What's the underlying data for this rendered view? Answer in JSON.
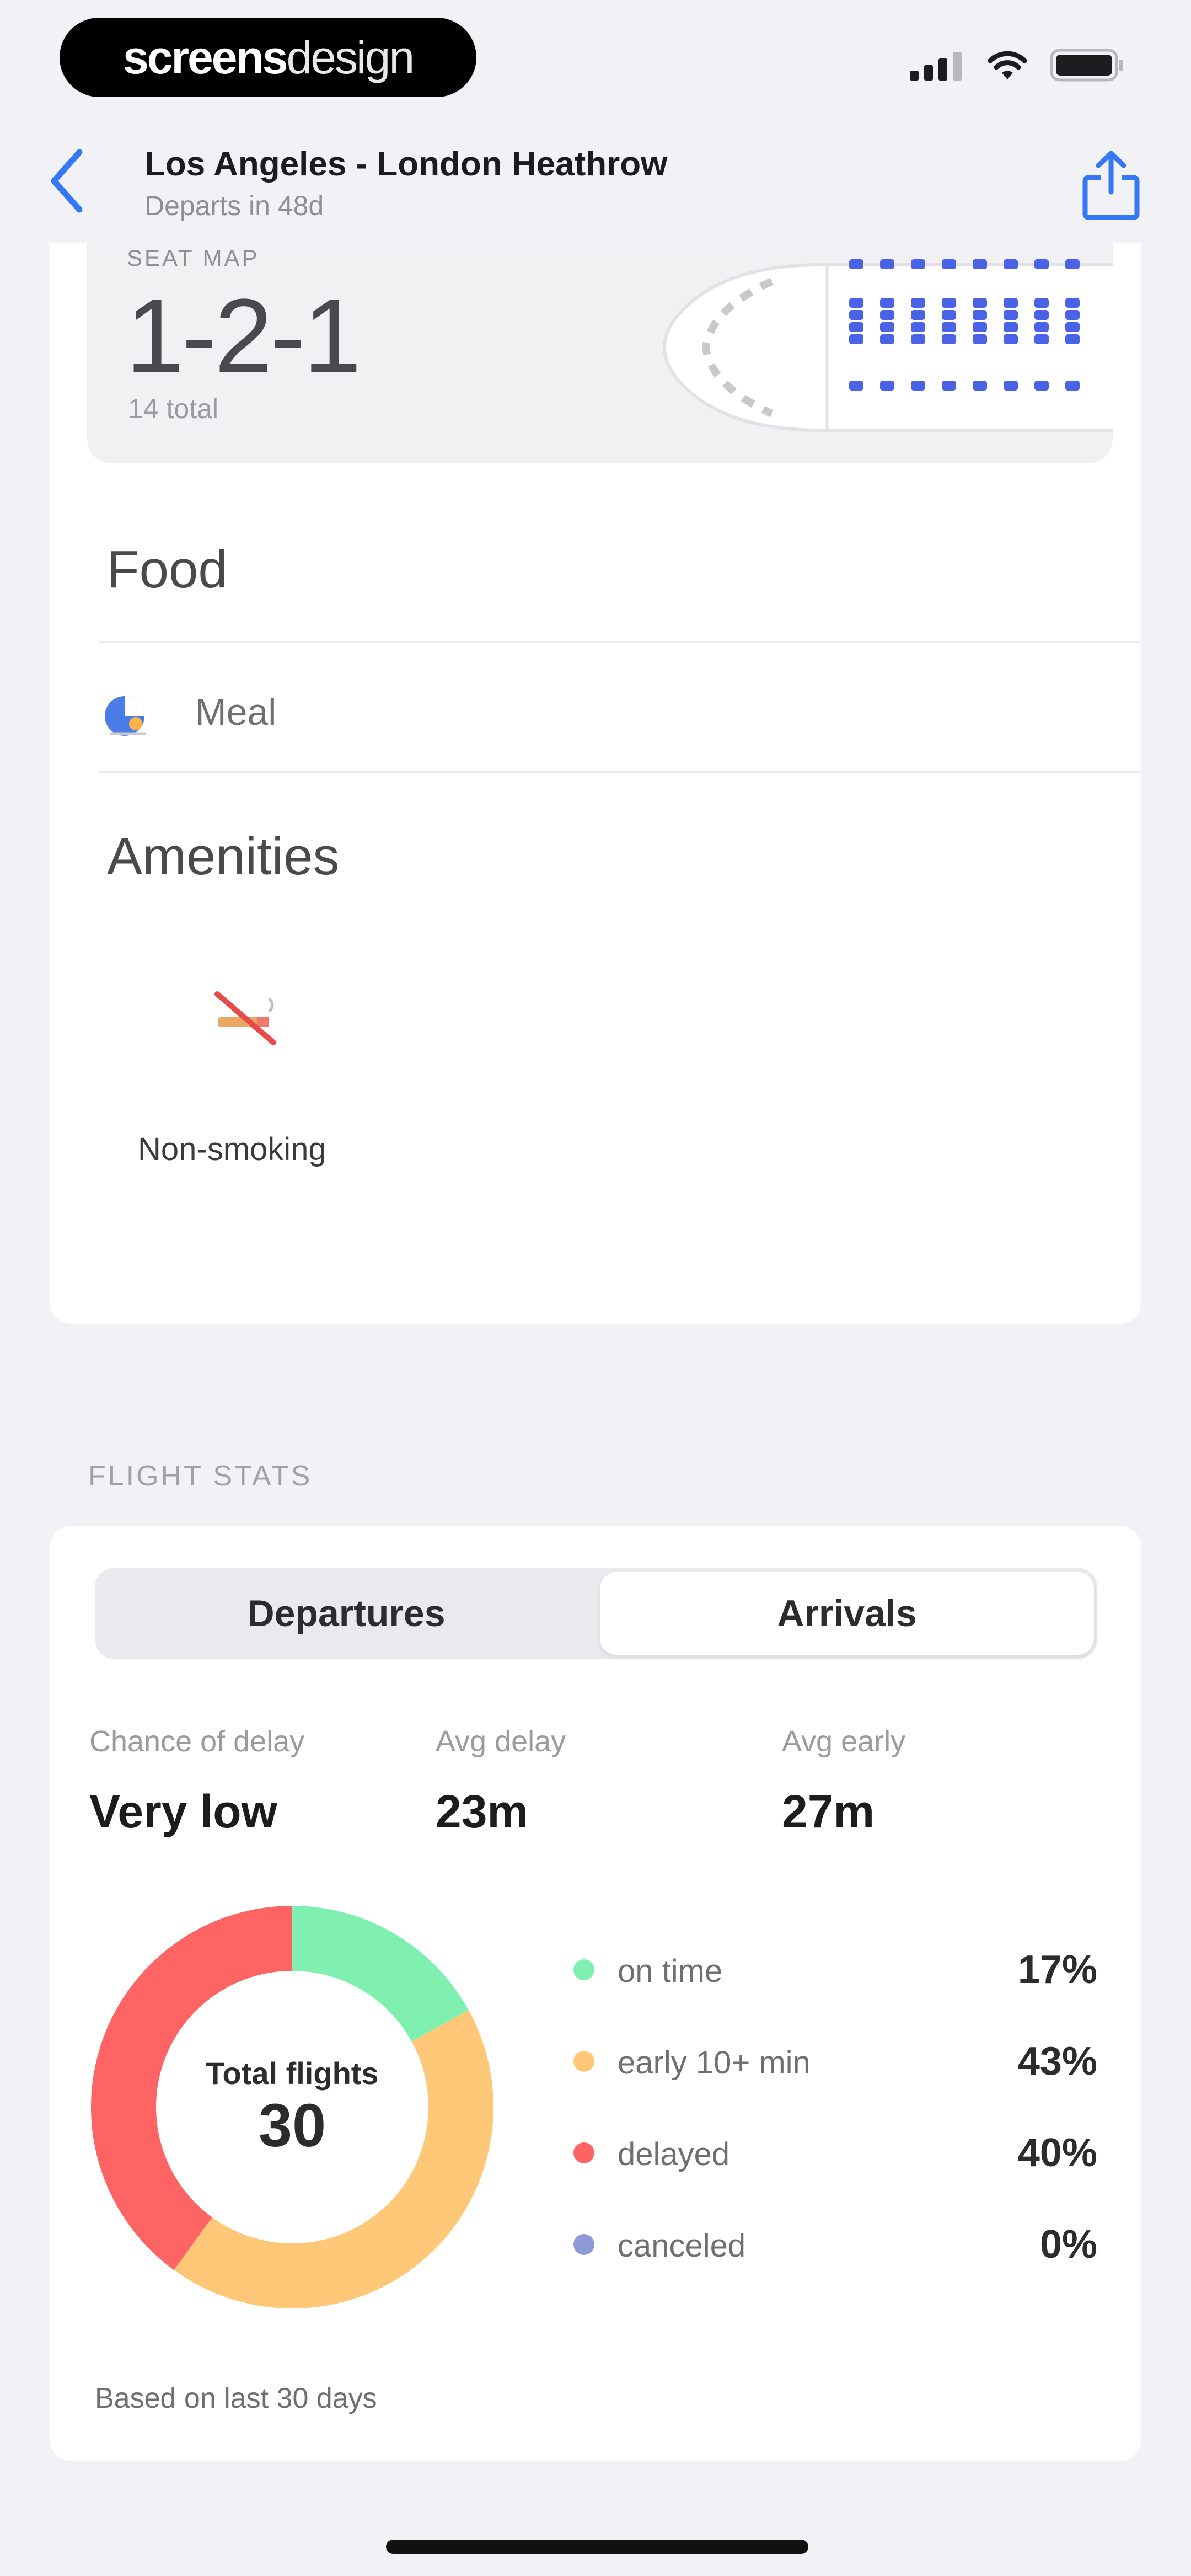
{
  "status_bar": {
    "logo_bold": "screens",
    "logo_light": "design"
  },
  "nav": {
    "title": "Los Angeles - London Heathrow",
    "subtitle": "Departs in 48d"
  },
  "seats": {
    "cut_label": "SEAT MAP",
    "config": "1-2-1",
    "total": "14 total"
  },
  "food": {
    "title": "Food",
    "items": [
      {
        "label": "Meal",
        "icon": "meal-icon"
      }
    ]
  },
  "amenities": {
    "title": "Amenities",
    "items": [
      {
        "label": "Non-smoking",
        "icon": "no-smoking-icon"
      }
    ]
  },
  "flight_stats": {
    "heading": "FLIGHT STATS",
    "tabs": [
      {
        "label": "Departures",
        "selected": false
      },
      {
        "label": "Arrivals",
        "selected": true
      }
    ],
    "summary": [
      {
        "label": "Chance of delay",
        "value": "Very low"
      },
      {
        "label": "Avg delay",
        "value": "23m"
      },
      {
        "label": "Avg early",
        "value": "27m"
      }
    ],
    "donut": {
      "caption": "Total flights",
      "total": "30"
    },
    "legend": [
      {
        "label": "on time",
        "pct": "17%",
        "color": "#7ff0b0"
      },
      {
        "label": "early 10+ min",
        "pct": "43%",
        "color": "#ffc778"
      },
      {
        "label": "delayed",
        "pct": "40%",
        "color": "#ff6464"
      },
      {
        "label": "canceled",
        "pct": "0%",
        "color": "#8e9ad6"
      }
    ],
    "footnote": "Based on last 30 days"
  },
  "chart_data": {
    "type": "pie",
    "title": "",
    "categories": [
      "on time",
      "early 10+ min",
      "delayed",
      "canceled"
    ],
    "values": [
      17,
      43,
      40,
      0
    ],
    "colors": [
      "#7ff0b0",
      "#ffc778",
      "#ff6464",
      "#8e9ad6"
    ],
    "center_label": "Total flights",
    "center_value": 30,
    "style": "donut"
  }
}
